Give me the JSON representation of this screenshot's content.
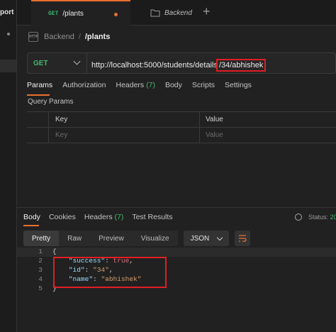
{
  "sidebar": {
    "label": "port"
  },
  "tabs": [
    {
      "method": "GET",
      "title": "/plants",
      "unsaved": true
    },
    {
      "title": "Backend"
    }
  ],
  "breadcrumb": {
    "collection": "Backend",
    "separator": "/",
    "request": "/plants"
  },
  "request": {
    "method": "GET",
    "url_prefix": "http://localhost:5000/students/details",
    "url_highlighted": "/34/abhishek"
  },
  "request_tabs": [
    {
      "label": "Params",
      "count": ""
    },
    {
      "label": "Authorization",
      "count": ""
    },
    {
      "label": "Headers",
      "count": "(7)"
    },
    {
      "label": "Body",
      "count": ""
    },
    {
      "label": "Scripts",
      "count": ""
    },
    {
      "label": "Settings",
      "count": ""
    }
  ],
  "query_params": {
    "title": "Query Params",
    "headers": {
      "key": "Key",
      "value": "Value"
    },
    "placeholders": {
      "key": "Key",
      "value": "Value"
    }
  },
  "response_tabs": [
    {
      "label": "Body",
      "count": ""
    },
    {
      "label": "Cookies",
      "count": ""
    },
    {
      "label": "Headers",
      "count": "(7)"
    },
    {
      "label": "Test Results",
      "count": ""
    }
  ],
  "status": {
    "label": "Status:",
    "value": "20"
  },
  "format_buttons": [
    "Pretty",
    "Raw",
    "Preview",
    "Visualize"
  ],
  "format_select": "JSON",
  "response_lines": [
    {
      "num": "1",
      "parts": [
        {
          "t": "{",
          "c": ""
        }
      ]
    },
    {
      "num": "2",
      "parts": [
        {
          "t": "    ",
          "c": ""
        },
        {
          "t": "\"success\"",
          "c": "k"
        },
        {
          "t": ": ",
          "c": ""
        },
        {
          "t": "true",
          "c": "b"
        },
        {
          "t": ",",
          "c": ""
        }
      ]
    },
    {
      "num": "3",
      "parts": [
        {
          "t": "    ",
          "c": ""
        },
        {
          "t": "\"id\"",
          "c": "k"
        },
        {
          "t": ": ",
          "c": ""
        },
        {
          "t": "\"34\"",
          "c": "s"
        },
        {
          "t": ",",
          "c": ""
        }
      ]
    },
    {
      "num": "4",
      "parts": [
        {
          "t": "    ",
          "c": ""
        },
        {
          "t": "\"name\"",
          "c": "k"
        },
        {
          "t": ": ",
          "c": ""
        },
        {
          "t": "\"abhishek\"",
          "c": "s"
        }
      ]
    },
    {
      "num": "5",
      "parts": [
        {
          "t": "}",
          "c": ""
        }
      ]
    }
  ],
  "colors": {
    "accent": "#e76f2f",
    "method_green": "#47b86f",
    "annotation_red": "#e01e23"
  }
}
